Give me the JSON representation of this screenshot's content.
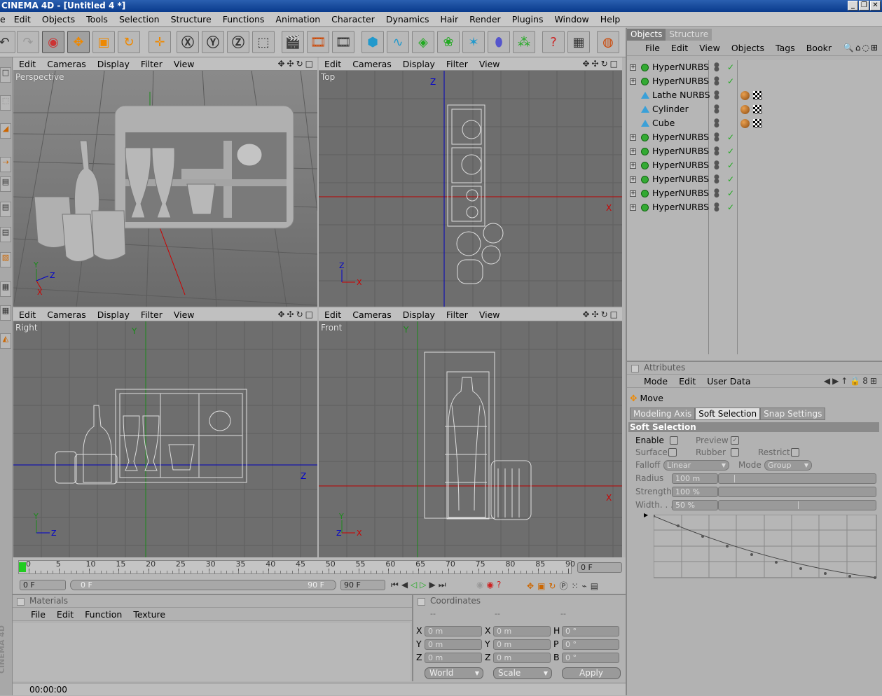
{
  "window": {
    "title": "CINEMA 4D - [Untitled 4 *]",
    "controls": [
      "_",
      "❐",
      "✕"
    ]
  },
  "menu": [
    "e",
    "Edit",
    "Objects",
    "Tools",
    "Selection",
    "Structure",
    "Functions",
    "Animation",
    "Character",
    "Dynamics",
    "Hair",
    "Render",
    "Plugins",
    "Window",
    "Help"
  ],
  "viewport_menu": [
    "Edit",
    "Cameras",
    "Display",
    "Filter",
    "View"
  ],
  "viewports": {
    "tl": "Perspective",
    "tr": "Top",
    "bl": "Right",
    "br": "Front"
  },
  "objects_panel": {
    "tabs": [
      "Objects",
      "Structure"
    ],
    "menu": [
      "File",
      "Edit",
      "View",
      "Objects",
      "Tags",
      "Bookr"
    ],
    "items": [
      {
        "name": "HyperNURBS",
        "type": "nurbs",
        "expandable": true,
        "checked": true,
        "tags": false
      },
      {
        "name": "HyperNURBS",
        "type": "nurbs",
        "expandable": true,
        "checked": true,
        "tags": false
      },
      {
        "name": "Lathe NURBS",
        "type": "prim",
        "expandable": false,
        "checked": false,
        "tags": true
      },
      {
        "name": "Cylinder",
        "type": "prim",
        "expandable": false,
        "checked": false,
        "tags": true
      },
      {
        "name": "Cube",
        "type": "prim",
        "expandable": false,
        "checked": false,
        "tags": true
      },
      {
        "name": "HyperNURBS",
        "type": "nurbs",
        "expandable": true,
        "checked": true,
        "tags": false
      },
      {
        "name": "HyperNURBS",
        "type": "nurbs",
        "expandable": true,
        "checked": true,
        "tags": false
      },
      {
        "name": "HyperNURBS",
        "type": "nurbs",
        "expandable": true,
        "checked": true,
        "tags": false
      },
      {
        "name": "HyperNURBS",
        "type": "nurbs",
        "expandable": true,
        "checked": true,
        "tags": false
      },
      {
        "name": "HyperNURBS",
        "type": "nurbs",
        "expandable": true,
        "checked": true,
        "tags": false
      },
      {
        "name": "HyperNURBS",
        "type": "nurbs",
        "expandable": true,
        "checked": true,
        "tags": false
      }
    ]
  },
  "attributes": {
    "header": "Attributes",
    "menu": [
      "Mode",
      "Edit",
      "User Data"
    ],
    "tool": "Move",
    "subtabs": [
      "Modeling Axis",
      "Soft Selection",
      "Snap Settings"
    ],
    "section": "Soft Selection",
    "enable": "Enable",
    "preview": "Preview",
    "surface": "Surface",
    "rubber": "Rubber",
    "restrict": "Restrict",
    "falloff_label": "Falloff",
    "falloff_value": "Linear",
    "mode_label": "Mode",
    "mode_value": "Group",
    "radius_label": "Radius",
    "radius_value": "100 m",
    "strength_label": "Strength",
    "strength_value": "100 %",
    "width_label": "Width. . .",
    "width_value": "50 %"
  },
  "timeline": {
    "ticks": [
      "0",
      "5",
      "10",
      "15",
      "20",
      "25",
      "30",
      "35",
      "40",
      "45",
      "50",
      "55",
      "60",
      "65",
      "70",
      "75",
      "80",
      "85",
      "90"
    ],
    "current_frame": "0 F",
    "start": "0 F",
    "range_start": "0 F",
    "range_end": "90 F",
    "end": "90 F"
  },
  "materials": {
    "header": "Materials",
    "menu": [
      "File",
      "Edit",
      "Function",
      "Texture"
    ]
  },
  "coordinates": {
    "header": "Coordinates",
    "cols": [
      "--",
      "--",
      "--"
    ],
    "rows": [
      {
        "a": "X",
        "av": "0 m",
        "b": "X",
        "bv": "0 m",
        "c": "H",
        "cv": "0 °"
      },
      {
        "a": "Y",
        "av": "0 m",
        "b": "Y",
        "bv": "0 m",
        "c": "P",
        "cv": "0 °"
      },
      {
        "a": "Z",
        "av": "0 m",
        "b": "Z",
        "bv": "0 m",
        "c": "B",
        "cv": "0 °"
      }
    ],
    "world": "World",
    "scale": "Scale",
    "apply": "Apply"
  },
  "status": {
    "time": "00:00:00",
    "brand": "CINEMA 4D"
  }
}
